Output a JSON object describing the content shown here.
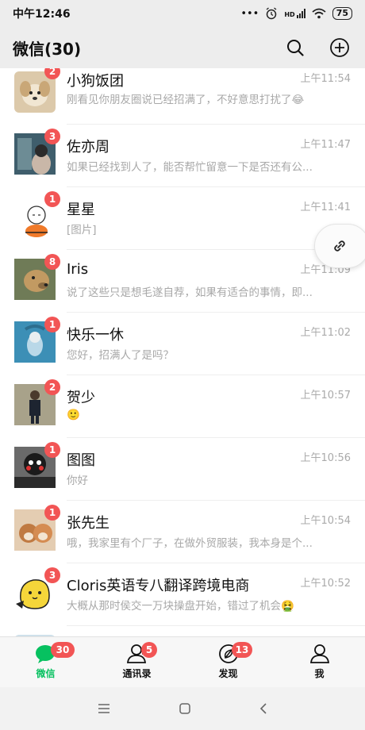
{
  "status_bar": {
    "time": "中午12:46",
    "dots": "•••",
    "network": "HD",
    "battery": "75"
  },
  "header": {
    "title": "微信(30)"
  },
  "chats": [
    {
      "name": "小狗饭团",
      "message": "刚看见你朋友圈说已经招满了，不好意思打扰了😂",
      "time": "上午11:54",
      "badge": "2",
      "avatar_color": "#d9c6a8"
    },
    {
      "name": "佐亦周",
      "message": "如果已经找到人了，能否帮忙留意一下是否还有公...",
      "time": "上午11:47",
      "badge": "3",
      "avatar_color": "#4a6a78"
    },
    {
      "name": "星星",
      "message": "[图片]",
      "time": "上午11:41",
      "badge": "1",
      "avatar_color": "#ffffff"
    },
    {
      "name": "Iris",
      "message": "说了这些只是想毛遂自荐，如果有适合的事情，即...",
      "time": "上午11:09",
      "badge": "8",
      "avatar_color": "#b08a5e"
    },
    {
      "name": "快乐一休",
      "message": "您好，招满人了是吗？",
      "time": "上午11:02",
      "badge": "1",
      "avatar_color": "#4fa8c9"
    },
    {
      "name": "贺少",
      "message": "🙂",
      "time": "上午10:57",
      "badge": "2",
      "avatar_color": "#5b5a4e"
    },
    {
      "name": "图图",
      "message": "你好",
      "time": "上午10:56",
      "badge": "1",
      "avatar_color": "#7a7a7a"
    },
    {
      "name": "张先生",
      "message": "哦，我家里有个厂子，在做外贸服装，我本身是个...",
      "time": "上午10:54",
      "badge": "1",
      "avatar_color": "#c98a5a"
    },
    {
      "name": "Cloris英语专八翻译跨境电商",
      "message": "大概从那时侯交一万块操盘开始，错过了机会🤮",
      "time": "上午10:52",
      "badge": "3",
      "avatar_color": "#f0d34a"
    }
  ],
  "tabs": [
    {
      "label": "微信",
      "badge": "30",
      "icon": "chat-bubble-icon",
      "active": true
    },
    {
      "label": "通讯录",
      "badge": "5",
      "icon": "contacts-icon",
      "active": false
    },
    {
      "label": "发现",
      "badge": "13",
      "icon": "compass-icon",
      "active": false
    },
    {
      "label": "我",
      "badge": "",
      "icon": "person-icon",
      "active": false
    }
  ],
  "colors": {
    "accent": "#07c160",
    "badge": "#f25555",
    "header_bg": "#ededed"
  }
}
